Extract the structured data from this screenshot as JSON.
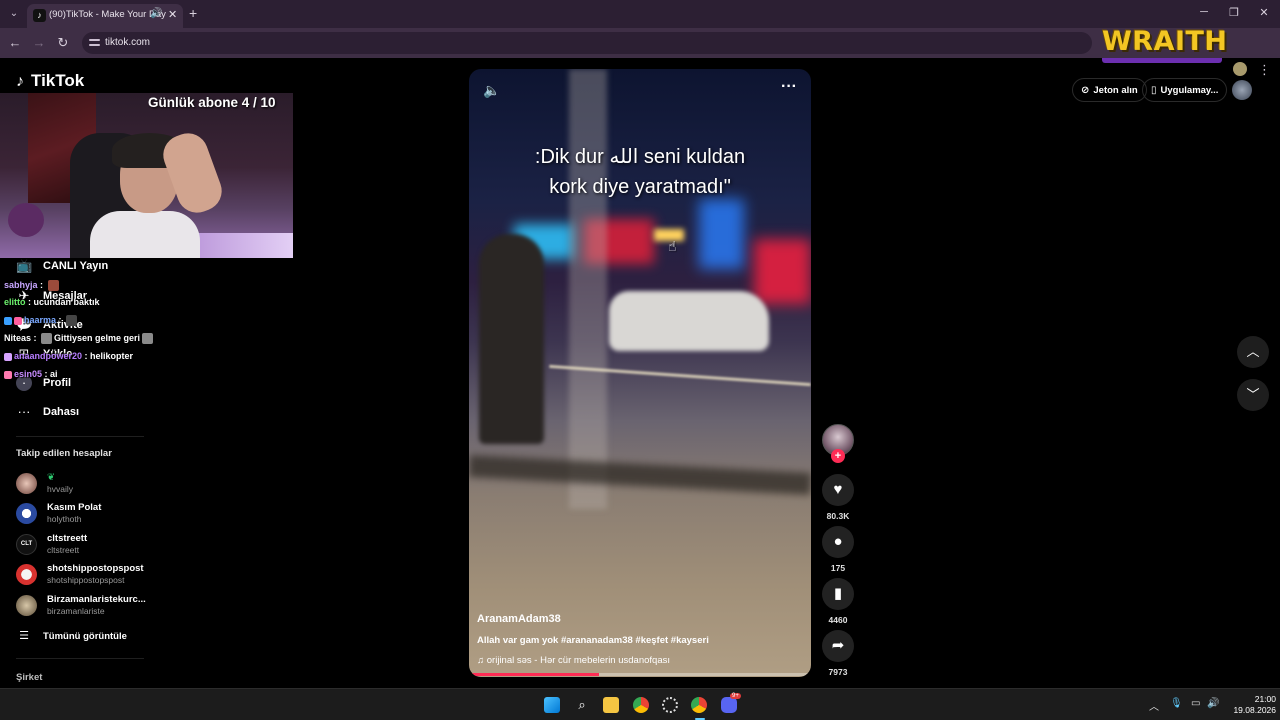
{
  "browser": {
    "tab_title": "(90)TikTok - Make Your Day",
    "url": "tiktok.com",
    "extension_banner": "WRAITH",
    "icons": {
      "tab_menu": "chevron-down-icon",
      "audio": "speaker-icon",
      "close": "close-icon",
      "new_tab": "plus-icon",
      "back": "arrow-left-icon",
      "forward": "arrow-right-icon",
      "reload": "reload-icon",
      "menu": "kebab-icon"
    }
  },
  "tiktok": {
    "logo_text": "TikTok",
    "nav": [
      {
        "label": "CANLI Yayın",
        "icon": "live-icon"
      },
      {
        "label": "Mesajlar",
        "icon": "message-icon"
      },
      {
        "label": "Aktivite",
        "icon": "activity-icon"
      },
      {
        "label": "Yükle",
        "icon": "upload-icon"
      },
      {
        "label": "Profil",
        "icon": "profile-icon"
      },
      {
        "label": "Dahası",
        "icon": "more-icon"
      }
    ],
    "following_title": "Takip edilen hesaplar",
    "following": [
      {
        "name": "",
        "handle": "hvvaily"
      },
      {
        "name": "Kasım Polat",
        "handle": "holythoth"
      },
      {
        "name": "cltstreett",
        "handle": "cltstreett"
      },
      {
        "name": "shotshippostopspost",
        "handle": "shotshippostopspost"
      },
      {
        "name": "Birzamanlaristekurc...",
        "handle": "birzamanlariste"
      }
    ],
    "see_all": "Tümünü görüntüle",
    "company": "Şirket",
    "top_right": {
      "coins": "Jeton alın",
      "app": "Uygulamay..."
    }
  },
  "stream_overlay": {
    "sub_goal": "Günlük abone 4 / 10",
    "chat": [
      {
        "user": "sabhyja",
        "msg": ""
      },
      {
        "user": "elitto",
        "msg": "ucundan baktık"
      },
      {
        "user": "haarma",
        "msg": ""
      },
      {
        "user": "Niteas",
        "msg": "Gittiysen gelme geri"
      },
      {
        "user": "anaandpower20",
        "msg": "helikopter"
      },
      {
        "user": "esin05",
        "msg": "ai"
      }
    ]
  },
  "video": {
    "caption_line1": ":Dik dur الله seni kuldan",
    "caption_line2": "kork diye yaratmadı\"",
    "author": "AranamAdam38",
    "description": "Allah var gam yok #arananadam38 #keşfet #kayseri",
    "music": "orijinal səs - Hər cür mebelerin usdanofqası",
    "progress": 0.38
  },
  "actions": {
    "likes": "80.3K",
    "comments": "175",
    "saves": "4460",
    "shares": "7973"
  },
  "taskbar": {
    "time": "21:00",
    "date": "19.08.2026",
    "discord_badge": "9+"
  }
}
